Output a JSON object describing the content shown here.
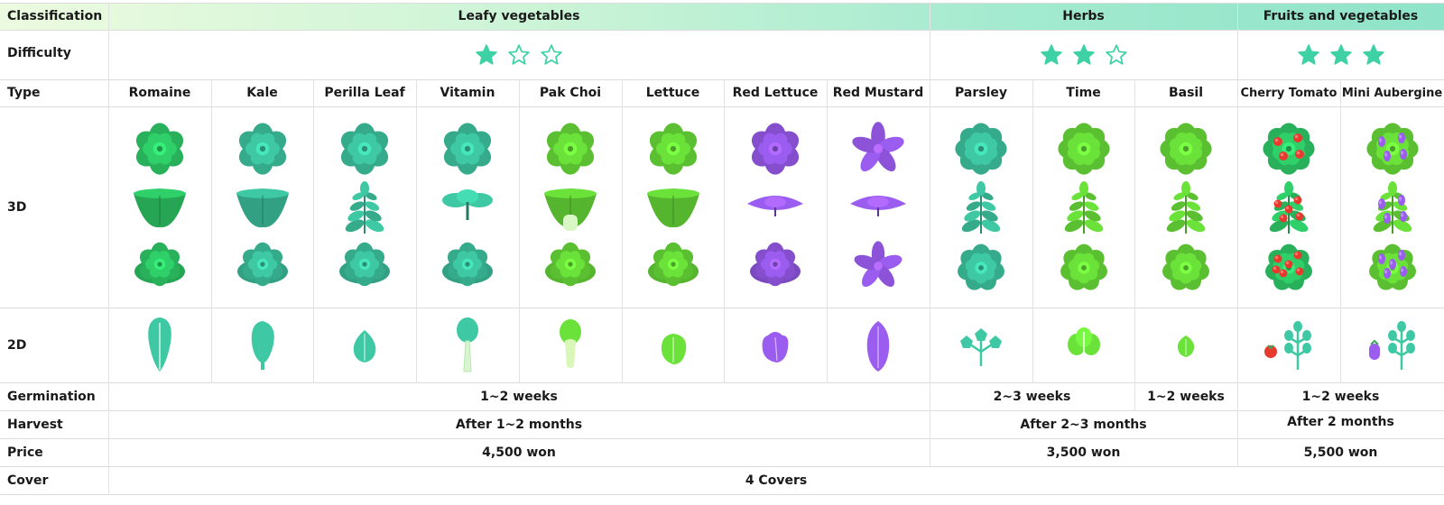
{
  "colors": {
    "accent": "#3ed1a5",
    "header_from": "#e9fbdc",
    "header_to": "#8fe6c8",
    "green": "#2fd06a",
    "lime": "#6be23a",
    "teal": "#3ec9a4",
    "purple": "#9b5cf0",
    "red": "#e8392f"
  },
  "row_labels": {
    "classification": "Classification",
    "difficulty": "Difficulty",
    "type": "Type",
    "three_d": "3D",
    "two_d": "2D",
    "germination": "Germination",
    "harvest": "Harvest",
    "price": "Price",
    "cover": "Cover"
  },
  "groups": [
    {
      "name": "Leafy vegetables",
      "difficulty": 1,
      "difficulty_max": 3
    },
    {
      "name": "Herbs",
      "difficulty": 2,
      "difficulty_max": 3
    },
    {
      "name": "Fruits and vegetables",
      "difficulty": 3,
      "difficulty_max": 3
    }
  ],
  "plants": [
    {
      "type": "Romaine",
      "color": "green",
      "icon": "long-leaf-icon"
    },
    {
      "type": "Kale",
      "color": "teal",
      "icon": "oval-leaf-icon"
    },
    {
      "type": "Perilla Leaf",
      "color": "teal",
      "icon": "drop-leaf-icon"
    },
    {
      "type": "Vitamin",
      "color": "teal",
      "icon": "stalk-leaf-icon"
    },
    {
      "type": "Pak Choi",
      "color": "lime",
      "icon": "bok-choy-icon"
    },
    {
      "type": "Lettuce",
      "color": "lime",
      "icon": "round-leaf-icon"
    },
    {
      "type": "Red Lettuce",
      "color": "purple",
      "icon": "ruffled-leaf-icon"
    },
    {
      "type": "Red Mustard",
      "color": "purple",
      "icon": "pointed-leaf-icon"
    },
    {
      "type": "Parsley",
      "color": "teal",
      "icon": "parsley-icon"
    },
    {
      "type": "Time",
      "color": "lime",
      "icon": "thyme-icon"
    },
    {
      "type": "Basil",
      "color": "lime",
      "icon": "basil-leaf-icon"
    },
    {
      "type": "Cherry Tomato",
      "color": "red",
      "icon": "tomato-icon"
    },
    {
      "type": "Mini Aubergine",
      "color": "purple",
      "icon": "aubergine-icon"
    }
  ],
  "germination": [
    "1~2 weeks",
    "2~3 weeks",
    "1~2 weeks",
    "1~2 weeks"
  ],
  "harvest": [
    "After 1~2 months",
    "After 2~3 months",
    "After 2 months"
  ],
  "price": [
    "4,500 won",
    "3,500 won",
    "5,500 won"
  ],
  "cover": "4 Covers"
}
